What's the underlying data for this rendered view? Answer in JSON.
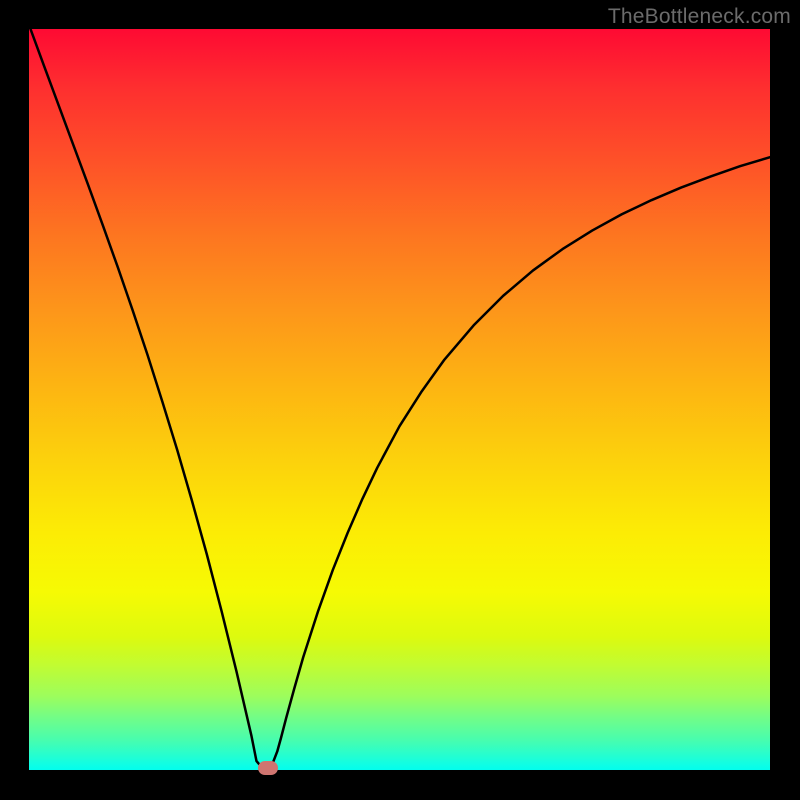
{
  "watermark": "TheBottleneck.com",
  "chart_data": {
    "type": "line",
    "title": "",
    "xlabel": "",
    "ylabel": "",
    "xlim": [
      0,
      1
    ],
    "ylim": [
      0,
      1
    ],
    "background": "rainbow-gradient",
    "curve_color": "#000000",
    "curve_stroke_width": 2.5,
    "x": [
      0.002,
      0.02,
      0.04,
      0.06,
      0.08,
      0.1,
      0.12,
      0.14,
      0.16,
      0.18,
      0.2,
      0.22,
      0.24,
      0.26,
      0.28,
      0.3,
      0.307,
      0.314,
      0.32,
      0.327,
      0.33,
      0.335,
      0.34,
      0.347,
      0.358,
      0.37,
      0.39,
      0.41,
      0.43,
      0.45,
      0.47,
      0.5,
      0.53,
      0.56,
      0.6,
      0.64,
      0.68,
      0.72,
      0.76,
      0.8,
      0.84,
      0.88,
      0.92,
      0.96,
      1.0
    ],
    "y": [
      1.0,
      0.951,
      0.897,
      0.843,
      0.789,
      0.734,
      0.678,
      0.62,
      0.56,
      0.497,
      0.432,
      0.363,
      0.291,
      0.214,
      0.133,
      0.047,
      0.012,
      0.004,
      0.003,
      0.006,
      0.012,
      0.025,
      0.043,
      0.07,
      0.11,
      0.152,
      0.214,
      0.27,
      0.32,
      0.366,
      0.408,
      0.464,
      0.511,
      0.553,
      0.6,
      0.64,
      0.674,
      0.703,
      0.728,
      0.75,
      0.769,
      0.786,
      0.801,
      0.815,
      0.827
    ],
    "marker": {
      "xy": [
        0.322,
        0.003
      ],
      "shape": "pill",
      "color": "#cf7570"
    }
  }
}
